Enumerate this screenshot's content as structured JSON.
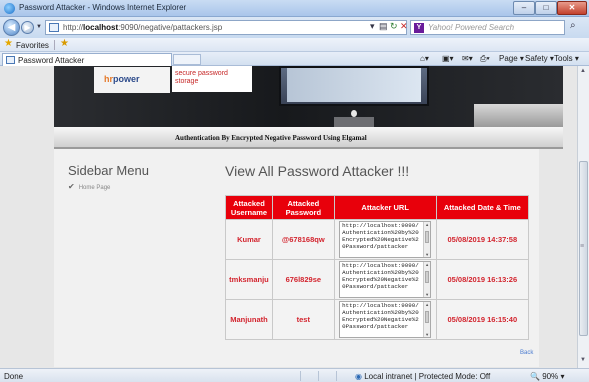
{
  "window": {
    "title": "Password Attacker - Windows Internet Explorer",
    "min": "–",
    "max": "□",
    "close": "✕"
  },
  "address": {
    "url_prefix": "http://",
    "url_host": "localhost",
    "url_rest": ":9090/negative/pattackers.jsp"
  },
  "search": {
    "placeholder": "Yahoo! Powered Search",
    "provider_icon": "Y"
  },
  "favorites": {
    "label": "Favorites"
  },
  "tab": {
    "label": "Password Attacker"
  },
  "commands": {
    "page": "Page ▾",
    "safety": "Safety ▾",
    "tools": "Tools ▾",
    "help": "❷▾"
  },
  "banner": {
    "logo_a": "hr",
    "logo_b": "power",
    "tagline": "secure password\nstorage",
    "subtitle": "Authentication By Encrypted Negative Password Using Elgamal"
  },
  "sidebar": {
    "title": "Sidebar Menu",
    "home_link": "Home Page"
  },
  "main": {
    "title": "View All Password Attacker !!!",
    "back_link": "Back",
    "columns": [
      "Attacked Username",
      "Attacked Password",
      "Attacker URL",
      "Attacked Date & Time"
    ],
    "rows": [
      {
        "username": "Kumar",
        "password": "@678168qw",
        "url": "http://localhost:9090/Authentication%20by%20Encrypted%20Negative%20Password/pattacker",
        "date": "05/08/2019 14:37:58"
      },
      {
        "username": "tmksmanju",
        "password": "676l829se",
        "url": "http://localhost:9090/Authentication%20by%20Encrypted%20Negative%20Password/pattacker",
        "date": "05/08/2019 16:13:26"
      },
      {
        "username": "Manjunath",
        "password": "test",
        "url": "http://localhost:9090/Authentication%20by%20Encrypted%20Negative%20Password/pattacker",
        "date": "05/08/2019 16:15:40"
      }
    ]
  },
  "status": {
    "left": "Done",
    "zone": "Local intranet | Protected Mode: Off",
    "zoom": "90%"
  },
  "colors": {
    "table_header": "#e8000b",
    "cell_text": "#d3242e",
    "link": "#4a7bd0"
  }
}
